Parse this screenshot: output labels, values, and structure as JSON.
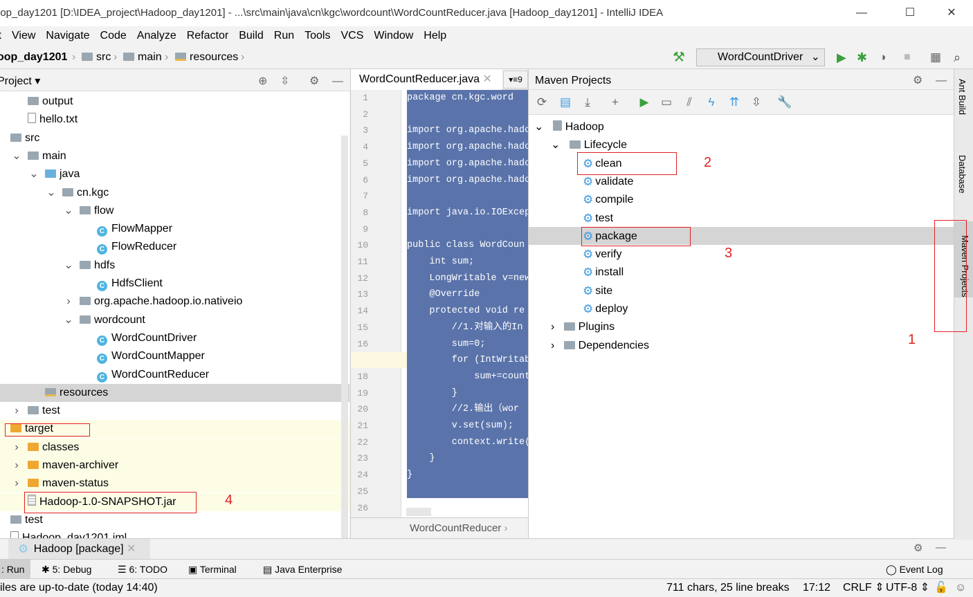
{
  "window": {
    "title": "oop_day1201 [D:\\IDEA_project\\Hadoop_day1201] - ...\\src\\main\\java\\cn\\kgc\\wordcount\\WordCountReducer.java [Hadoop_day1201] - IntelliJ IDEA",
    "minimize": "—",
    "maximize": "☐",
    "close": "✕"
  },
  "menu": [
    "it",
    "View",
    "Navigate",
    "Code",
    "Analyze",
    "Refactor",
    "Build",
    "Run",
    "Tools",
    "VCS",
    "Window",
    "Help"
  ],
  "breadcrumb": [
    "oop_day1201",
    "src",
    "main",
    "resources"
  ],
  "run_config": "WordCountDriver",
  "project": {
    "title": "Project",
    "tree": [
      {
        "label": "output",
        "type": "folder",
        "indent": 1
      },
      {
        "label": "hello.txt",
        "type": "file",
        "indent": 1
      },
      {
        "label": "src",
        "type": "folder",
        "indent": 0
      },
      {
        "label": "main",
        "type": "folder",
        "indent": 1,
        "expanded": true
      },
      {
        "label": "java",
        "type": "folder-blue",
        "indent": 2,
        "expanded": true
      },
      {
        "label": "cn.kgc",
        "type": "package",
        "indent": 3,
        "expanded": true
      },
      {
        "label": "flow",
        "type": "package",
        "indent": 4,
        "expanded": true
      },
      {
        "label": "FlowMapper",
        "type": "class",
        "indent": 5
      },
      {
        "label": "FlowReducer",
        "type": "class",
        "indent": 5
      },
      {
        "label": "hdfs",
        "type": "package",
        "indent": 4,
        "expanded": true
      },
      {
        "label": "HdfsClient",
        "type": "class-run",
        "indent": 5
      },
      {
        "label": "org.apache.hadoop.io.nativeio",
        "type": "package",
        "indent": 4,
        "expanded": false
      },
      {
        "label": "wordcount",
        "type": "package",
        "indent": 4,
        "expanded": true
      },
      {
        "label": "WordCountDriver",
        "type": "class-run",
        "indent": 5
      },
      {
        "label": "WordCountMapper",
        "type": "class",
        "indent": 5
      },
      {
        "label": "WordCountReducer",
        "type": "class",
        "indent": 5
      },
      {
        "label": "resources",
        "type": "folder-res",
        "indent": 2,
        "selected": true
      },
      {
        "label": "test",
        "type": "folder",
        "indent": 1,
        "expanded": false
      },
      {
        "label": "target",
        "type": "folder-orange",
        "indent": 0,
        "highlight": true
      },
      {
        "label": "classes",
        "type": "folder-orange",
        "indent": 1,
        "expanded": false,
        "highlight": true
      },
      {
        "label": "maven-archiver",
        "type": "folder-orange",
        "indent": 1,
        "expanded": false,
        "highlight": true
      },
      {
        "label": "maven-status",
        "type": "folder-orange",
        "indent": 1,
        "expanded": false,
        "highlight": true
      },
      {
        "label": "Hadoop-1.0-SNAPSHOT.jar",
        "type": "jar",
        "indent": 1,
        "highlight": true
      },
      {
        "label": "test",
        "type": "folder",
        "indent": 0
      },
      {
        "label": "Hadoop_day1201.iml",
        "type": "file",
        "indent": 0
      }
    ]
  },
  "editor": {
    "tab": "WordCountReducer.java",
    "tab_count": "9",
    "footer": "WordCountReducer",
    "lines": [
      "package cn.kgc.word",
      "",
      "import org.apache.hado",
      "import org.apache.hado",
      "import org.apache.hado",
      "import org.apache.hado",
      "",
      "import java.io.IOExcep",
      "",
      "public class WordCoun",
      "    int sum;",
      "    LongWritable v=new",
      "    @Override",
      "    protected void re",
      "        //1.对输入的In",
      "        sum=0;",
      "        for (IntWritab",
      "            sum+=count",
      "        }",
      "        //2.输出（wor",
      "        v.set(sum);",
      "        context.write(",
      "    }",
      "}",
      "",
      ""
    ]
  },
  "maven": {
    "title": "Maven Projects",
    "root": "Hadoop",
    "lifecycle_label": "Lifecycle",
    "phases": [
      "clean",
      "validate",
      "compile",
      "test",
      "package",
      "verify",
      "install",
      "site",
      "deploy"
    ],
    "selected_phase": "package",
    "plugins": "Plugins",
    "dependencies": "Dependencies"
  },
  "right_tabs": [
    "Ant Build",
    "Database",
    "Maven Projects"
  ],
  "run_tab": "Hadoop [package]",
  "tool_windows": [
    {
      "label": ": Run"
    },
    {
      "label": "5: Debug"
    },
    {
      "label": "6: TODO"
    },
    {
      "label": "Terminal"
    },
    {
      "label": "Java Enterprise"
    },
    {
      "label": "Event Log"
    }
  ],
  "status": {
    "message": "iles are up-to-date (today 14:40)",
    "chars": "711 chars, 25 line breaks",
    "position": "17:12",
    "line_sep": "CRLF ⇕",
    "encoding": "UTF-8 ⇕"
  },
  "annotations": [
    "1",
    "2",
    "3",
    "4"
  ],
  "colors": {
    "accent_red": "#e02020",
    "selection": "#d5d5d5",
    "code_bg": "#5a73aa",
    "run_green": "#3ba03b"
  }
}
